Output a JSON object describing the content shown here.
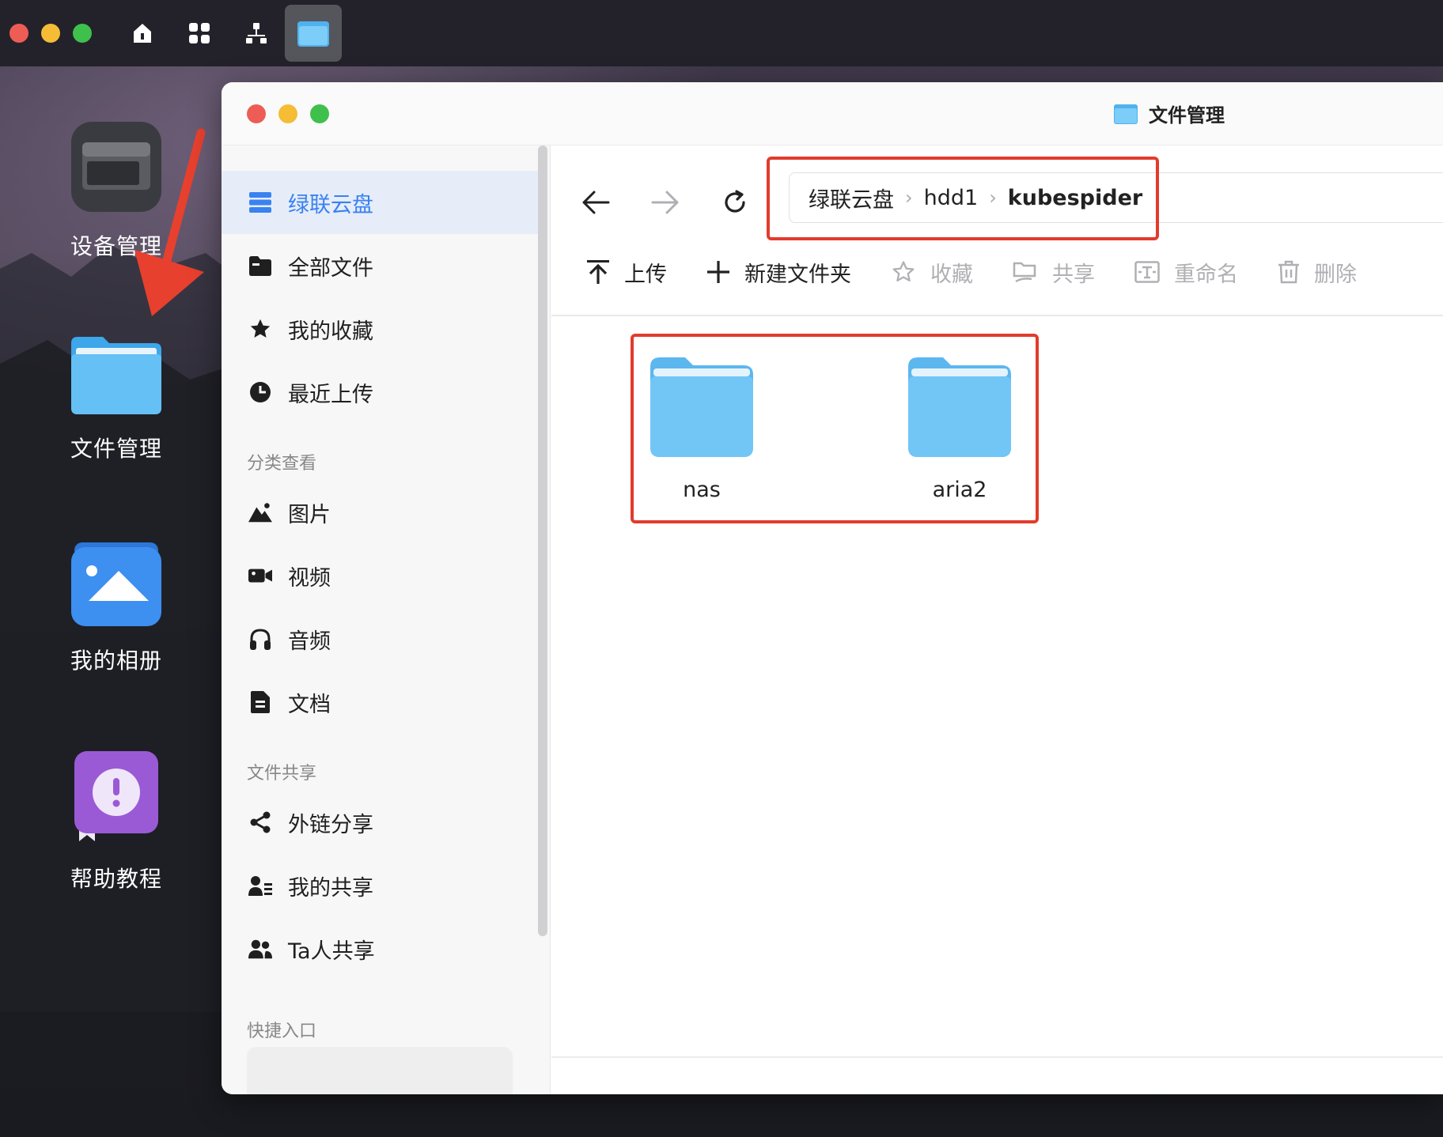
{
  "window": {
    "title": "文件管理"
  },
  "desktop": {
    "icons": [
      {
        "label": "设备管理"
      },
      {
        "label": "文件管理"
      },
      {
        "label": "我的相册"
      },
      {
        "label": "帮助教程"
      }
    ]
  },
  "sidebar": {
    "top_items": [
      {
        "label": "绿联云盘",
        "icon": "server-icon",
        "active": true
      },
      {
        "label": "全部文件",
        "icon": "folder-icon"
      },
      {
        "label": "我的收藏",
        "icon": "star-icon"
      },
      {
        "label": "最近上传",
        "icon": "clock-icon"
      }
    ],
    "category_title": "分类查看",
    "category_items": [
      {
        "label": "图片",
        "icon": "image-icon"
      },
      {
        "label": "视频",
        "icon": "video-icon"
      },
      {
        "label": "音频",
        "icon": "headphones-icon"
      },
      {
        "label": "文档",
        "icon": "document-icon"
      }
    ],
    "share_title": "文件共享",
    "share_items": [
      {
        "label": "外链分享",
        "icon": "share-icon"
      },
      {
        "label": "我的共享",
        "icon": "user-share-icon"
      },
      {
        "label": "Ta人共享",
        "icon": "users-icon"
      }
    ],
    "quick_title": "快捷入口"
  },
  "path": {
    "crumbs": [
      "绿联云盘",
      "hdd1",
      "kubespider"
    ]
  },
  "toolbar": {
    "upload": "上传",
    "new_folder": "新建文件夹",
    "favorite": "收藏",
    "share": "共享",
    "rename": "重命名",
    "delete": "删除"
  },
  "files": [
    {
      "name": "nas"
    },
    {
      "name": "aria2"
    }
  ],
  "colors": {
    "accent": "#3a82f0",
    "highlight_box": "#e23b2c",
    "arrow": "#e8402e",
    "folder": "#6ec3f5"
  }
}
